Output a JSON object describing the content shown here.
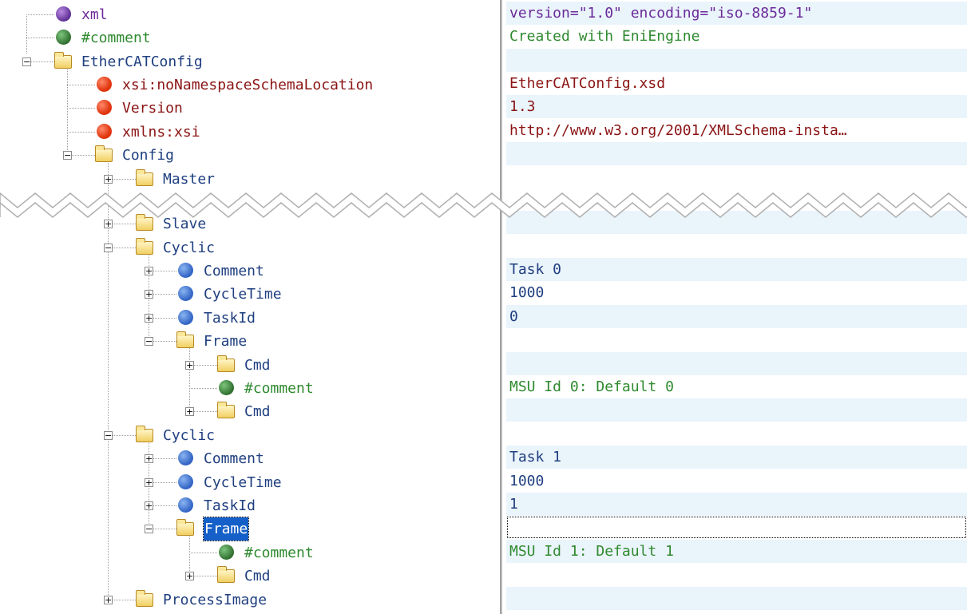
{
  "tree": [
    {
      "label": "xml",
      "icon": "purple-ball-icon",
      "value": "version=\"1.0\" encoding=\"iso-8859-1\""
    },
    {
      "label": "#comment",
      "icon": "green-ball-icon",
      "value": "Created with EniEngine"
    },
    {
      "label": "EtherCATConfig",
      "icon": "folder-icon",
      "value": ""
    },
    {
      "label": "xsi:noNamespaceSchemaLocation",
      "icon": "red-ball-icon",
      "value": "EtherCATConfig.xsd"
    },
    {
      "label": "Version",
      "icon": "red-ball-icon",
      "value": "1.3"
    },
    {
      "label": "xmlns:xsi",
      "icon": "red-ball-icon",
      "value": "http://www.w3.org/2001/XMLSchema-insta…"
    },
    {
      "label": "Config",
      "icon": "folder-icon",
      "value": ""
    },
    {
      "label": "Master",
      "icon": "folder-icon",
      "value": ""
    },
    {
      "label": "Slave",
      "icon": "folder-icon",
      "value": ""
    },
    {
      "label": "Cyclic",
      "icon": "folder-icon",
      "value": ""
    },
    {
      "label": "Comment",
      "icon": "blue-ball-icon",
      "value": "Task 0"
    },
    {
      "label": "CycleTime",
      "icon": "blue-ball-icon",
      "value": "1000"
    },
    {
      "label": "TaskId",
      "icon": "blue-ball-icon",
      "value": "0"
    },
    {
      "label": "Frame",
      "icon": "folder-icon",
      "value": ""
    },
    {
      "label": "Cmd",
      "icon": "folder-icon",
      "value": ""
    },
    {
      "label": "#comment",
      "icon": "green-ball-icon",
      "value": "MSU Id 0: Default 0"
    },
    {
      "label": "Cmd",
      "icon": "folder-icon",
      "value": ""
    },
    {
      "label": "Cyclic",
      "icon": "folder-icon",
      "value": ""
    },
    {
      "label": "Comment",
      "icon": "blue-ball-icon",
      "value": "Task 1"
    },
    {
      "label": "CycleTime",
      "icon": "blue-ball-icon",
      "value": "1000"
    },
    {
      "label": "TaskId",
      "icon": "blue-ball-icon",
      "value": "1"
    },
    {
      "label": "Frame",
      "icon": "folder-icon",
      "value": "",
      "selected": true
    },
    {
      "label": "#comment",
      "icon": "green-ball-icon",
      "value": "MSU Id 1: Default 1"
    },
    {
      "label": "Cmd",
      "icon": "folder-icon",
      "value": ""
    },
    {
      "label": "ProcessImage",
      "icon": "folder-icon",
      "value": ""
    }
  ],
  "expanders": {
    "plus": "+",
    "minus": "−"
  },
  "colors": {
    "selection": "#1560c8",
    "alt_row": "#eaf4fb",
    "attribute": "#8b1414",
    "element": "#1f3f80",
    "comment": "#2f8a2f"
  }
}
